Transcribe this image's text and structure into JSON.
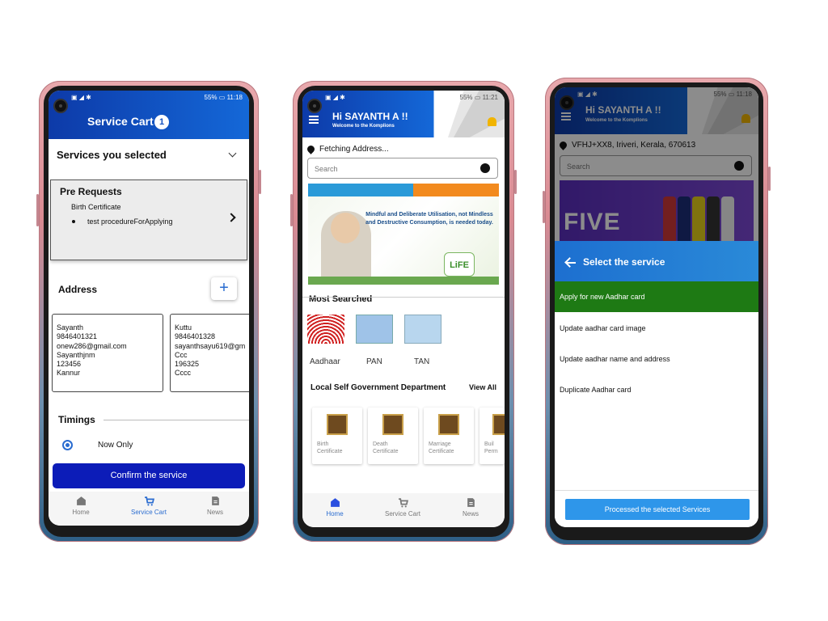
{
  "phone1": {
    "status": {
      "battery": "55%",
      "time": "11:18"
    },
    "title": "Service Cart",
    "cart_count": "1",
    "services_selected": "Services you selected",
    "prerequests": {
      "title": "Pre Requests",
      "subtitle": "Birth Certificate",
      "item": "test procedureForApplying"
    },
    "address": {
      "heading": "Address",
      "add_label": "+",
      "cards": [
        {
          "name": "Sayanth",
          "phone": "9846401321",
          "email": "onew286@gmail.com",
          "house": "Sayanthjnm",
          "pin": "123456",
          "district": "Kannur"
        },
        {
          "name": "Kuttu",
          "phone": "9846401328",
          "email": "sayanthsayu619@gm",
          "house": "Ccc",
          "pin": "196325",
          "district": "Cccc"
        }
      ]
    },
    "timings": {
      "heading": "Timings",
      "option": "Now Only"
    },
    "confirm_label": "Confirm the service",
    "nav": {
      "home": "Home",
      "cart": "Service Cart",
      "news": "News"
    }
  },
  "phone2": {
    "status": {
      "battery": "55%",
      "time": "11:21"
    },
    "greeting": "Hi SAYANTH A  !!",
    "welcome": "Welcome to the Komplions",
    "location": "Fetching Address...",
    "search_placeholder": "Search",
    "banner": {
      "quote": "Mindful and Deliberate Utilisation, not Mindless and Destructive Consumption, is needed today.",
      "badge": "LiFE"
    },
    "most_searched": {
      "heading": "Most Searched",
      "items": [
        "Aadhaar",
        "PAN",
        "TAN"
      ]
    },
    "lsg": {
      "heading": "Local Self Government Department",
      "view_all": "View All",
      "cards": [
        {
          "line1": "Birth",
          "line2": "Certificate"
        },
        {
          "line1": "Death",
          "line2": "Certificate"
        },
        {
          "line1": "Marriage",
          "line2": "Certificate"
        },
        {
          "line1": "Buil",
          "line2": "Perm"
        }
      ]
    },
    "nav": {
      "home": "Home",
      "cart": "Service Cart",
      "news": "News"
    }
  },
  "phone3": {
    "status": {
      "battery": "55%",
      "time": "11:18"
    },
    "greeting": "Hi SAYANTH A  !!",
    "welcome": "Welcome to the Komplions",
    "location": "VFHJ+XX8,  Iriveri, Kerala, 670613",
    "search_placeholder": "Search",
    "banner_text": "FIVE",
    "sheet": {
      "title": "Select the service",
      "options": [
        "Apply for new Aadhar card",
        "Update aadhar card image",
        "Update aadhar name and address",
        "Duplicate Aadhar card"
      ],
      "process_label": "Processed the selected Services"
    }
  },
  "colors": {
    "header_blue": "#0d3aa8",
    "accent_blue": "#2a6cd0",
    "confirm_blue": "#0c1cb8",
    "selected_green": "#1e7a14",
    "bell_yellow": "#f1b400"
  }
}
